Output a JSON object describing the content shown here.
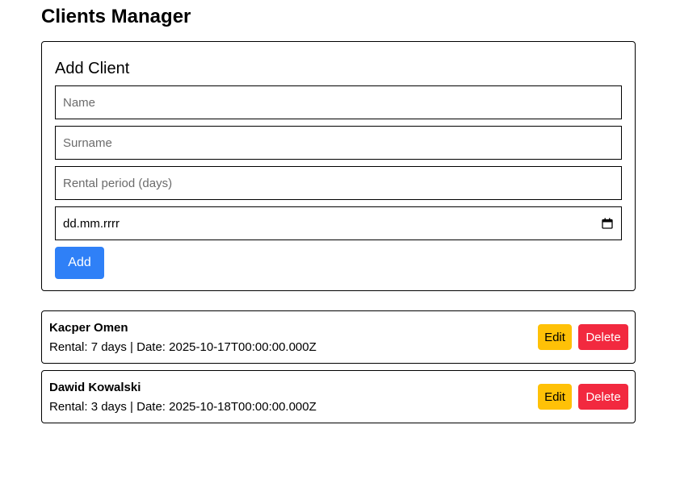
{
  "page": {
    "title": "Clients Manager"
  },
  "form": {
    "heading": "Add Client",
    "name_placeholder": "Name",
    "surname_placeholder": "Surname",
    "rental_placeholder": "Rental period (days)",
    "date_placeholder": "dd.mm.rrrr",
    "add_label": "Add",
    "calendar_icon": "calendar-icon"
  },
  "clients": [
    {
      "name": "Kacper Omen",
      "details": "Rental: 7 days | Date: 2025-10-17T00:00:00.000Z",
      "edit_label": "Edit",
      "delete_label": "Delete"
    },
    {
      "name": "Dawid Kowalski",
      "details": "Rental: 3 days | Date: 2025-10-18T00:00:00.000Z",
      "edit_label": "Edit",
      "delete_label": "Delete"
    }
  ],
  "colors": {
    "primary": "#2f80f7",
    "warning": "#ffc107",
    "danger": "#f2293f"
  }
}
